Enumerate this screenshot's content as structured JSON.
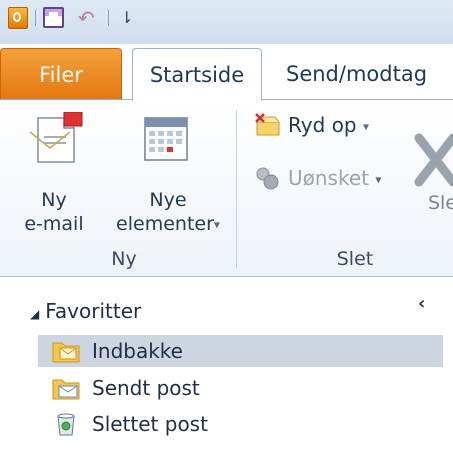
{
  "quick_access": {
    "app_icon": "outlook-icon",
    "save_icon": "save-icon",
    "undo_icon": "undo-icon",
    "undo_glyph": "↶",
    "customize_icon": "customize-qat-icon",
    "customize_glyph": "⇂"
  },
  "tabs": [
    {
      "label": "Filer"
    },
    {
      "label": "Startside"
    },
    {
      "label": "Send/modtag"
    }
  ],
  "ribbon": {
    "new_group": {
      "label": "Ny",
      "new_email": {
        "line1": "Ny",
        "line2": "e-mail",
        "icon": "new-email-icon"
      },
      "new_items": {
        "line1": "Nye",
        "line2": "elementer",
        "icon": "new-items-icon"
      }
    },
    "delete_group": {
      "label": "Slet",
      "cleanup": {
        "label": "Ryd op",
        "icon": "cleanup-icon"
      },
      "junk": {
        "label": "Uønsket",
        "icon": "junk-icon"
      },
      "delete": {
        "label": "Sle",
        "icon": "delete-icon"
      }
    },
    "dropdown_glyph": "▾"
  },
  "folder_pane": {
    "favorites_label": "Favoritter",
    "collapse_glyph": "◢",
    "pane_collapse_glyph": "‹",
    "folders": [
      {
        "label": "Indbakke",
        "icon": "inbox-folder-icon",
        "selected": true
      },
      {
        "label": "Sendt post",
        "icon": "sent-folder-icon",
        "selected": false
      },
      {
        "label": "Slettet post",
        "icon": "deleted-items-icon",
        "selected": false
      }
    ]
  },
  "colors": {
    "file_tab": "#e5760f",
    "selected_row": "#cdd5e0",
    "title_bar": "#dfe9f5"
  }
}
